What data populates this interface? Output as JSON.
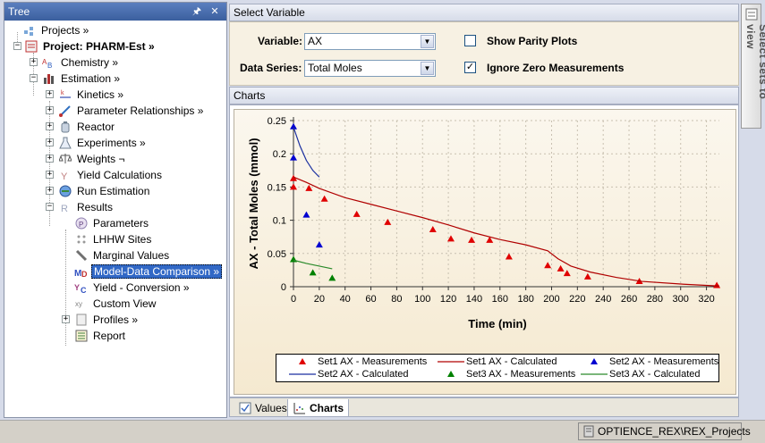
{
  "tree": {
    "title": "Tree",
    "pin_icon": "pin-icon",
    "close_icon": "close-icon",
    "items": [
      {
        "label": "Projects »",
        "icon": "projects-icon"
      },
      {
        "label": "Project: PHARM-Est »",
        "icon": "project-icon"
      },
      {
        "label": "Chemistry »",
        "icon": "chemistry-icon"
      },
      {
        "label": "Estimation »",
        "icon": "estimation-icon"
      },
      {
        "label": "Kinetics »",
        "icon": "kinetics-icon"
      },
      {
        "label": "Parameter Relationships »",
        "icon": "relationships-icon"
      },
      {
        "label": "Reactor",
        "icon": "reactor-icon"
      },
      {
        "label": "Experiments »",
        "icon": "flask-icon"
      },
      {
        "label": "Weights ¬",
        "icon": "weights-icon"
      },
      {
        "label": "Yield Calculations",
        "icon": "yield-icon"
      },
      {
        "label": "Run Estimation",
        "icon": "run-estimation-icon"
      },
      {
        "label": "Results",
        "icon": "results-icon"
      },
      {
        "label": "Parameters",
        "icon": "parameters-icon"
      },
      {
        "label": "LHHW Sites",
        "icon": "lhhw-icon"
      },
      {
        "label": "Marginal Values",
        "icon": "marginal-icon"
      },
      {
        "label": "Model-Data Comparison »",
        "icon": "model-data-icon"
      },
      {
        "label": "Yield - Conversion »",
        "icon": "yield-conversion-icon"
      },
      {
        "label": "Custom View",
        "icon": "custom-view-icon"
      },
      {
        "label": "Profiles »",
        "icon": "profiles-icon"
      },
      {
        "label": "Report",
        "icon": "report-icon"
      }
    ]
  },
  "select_variable": {
    "header": "Select Variable",
    "variable_label": "Variable:",
    "variable_value": "AX",
    "series_label": "Data Series:",
    "series_value": "Total Moles",
    "show_parity_label": "Show Parity Plots",
    "show_parity_checked": false,
    "ignore_zero_label": "Ignore Zero Measurements",
    "ignore_zero_checked": true,
    "checkmark": "✓"
  },
  "charts": {
    "header": "Charts",
    "side_tab": "Select sets to view"
  },
  "bottom_tabs": [
    {
      "label": "Values",
      "active": false
    },
    {
      "label": "Charts",
      "active": true
    }
  ],
  "status": {
    "text": "OPTIENCE_REX\\REX_Projects"
  },
  "colors": {
    "set1": "#e00000",
    "set2": "#0000d0",
    "set3": "#008000",
    "calc1": "#b00000",
    "calc2": "#1a2fa0",
    "calc3": "#2a8a2a"
  },
  "chart_data": {
    "type": "scatter",
    "xlabel": "Time (min)",
    "ylabel": "AX - Total Moles (mmol)",
    "xlim": [
      0,
      330
    ],
    "ylim": [
      0,
      0.25
    ],
    "xticks": [
      0,
      20,
      40,
      60,
      80,
      100,
      120,
      140,
      160,
      180,
      200,
      220,
      240,
      260,
      280,
      300,
      320
    ],
    "yticks": [
      0,
      0.05,
      0.1,
      0.15,
      0.2,
      0.25
    ],
    "ytick_labels": [
      "0",
      "0.05",
      "0.1",
      "0.15",
      "0.2",
      "0.25"
    ],
    "grid": "dotted",
    "legend_position": "bottom",
    "series": [
      {
        "name": "Set1 AX - Measurements",
        "kind": "points",
        "color": "#e00000",
        "x": [
          0,
          0,
          12,
          24,
          49,
          73,
          108,
          122,
          138,
          152,
          167,
          197,
          207,
          212,
          228,
          268,
          328
        ],
        "y": [
          0.163,
          0.15,
          0.148,
          0.132,
          0.109,
          0.097,
          0.086,
          0.072,
          0.07,
          0.07,
          0.045,
          0.032,
          0.027,
          0.02,
          0.015,
          0.008,
          0.002
        ]
      },
      {
        "name": "Set1 AX - Calculated",
        "kind": "line",
        "color": "#b00000",
        "x": [
          0,
          10,
          20,
          40,
          60,
          80,
          100,
          120,
          140,
          160,
          180,
          197,
          205,
          215,
          230,
          250,
          270,
          300,
          330
        ],
        "y": [
          0.165,
          0.157,
          0.148,
          0.134,
          0.124,
          0.114,
          0.104,
          0.093,
          0.081,
          0.071,
          0.063,
          0.054,
          0.042,
          0.031,
          0.022,
          0.014,
          0.008,
          0.004,
          0.001
        ]
      },
      {
        "name": "Set2 AX - Measurements",
        "kind": "points",
        "color": "#0000d0",
        "x": [
          0,
          0,
          10,
          20
        ],
        "y": [
          0.241,
          0.194,
          0.108,
          0.063
        ]
      },
      {
        "name": "Set2 AX - Calculated",
        "kind": "line",
        "color": "#1a2fa0",
        "x": [
          0,
          5,
          10,
          15,
          20
        ],
        "y": [
          0.24,
          0.212,
          0.19,
          0.175,
          0.165
        ]
      },
      {
        "name": "Set3 AX - Measurements",
        "kind": "points",
        "color": "#008000",
        "x": [
          0,
          15,
          30
        ],
        "y": [
          0.041,
          0.021,
          0.013
        ]
      },
      {
        "name": "Set3 AX - Calculated",
        "kind": "line",
        "color": "#2a8a2a",
        "x": [
          0,
          10,
          20,
          30
        ],
        "y": [
          0.04,
          0.035,
          0.031,
          0.027
        ]
      }
    ]
  }
}
